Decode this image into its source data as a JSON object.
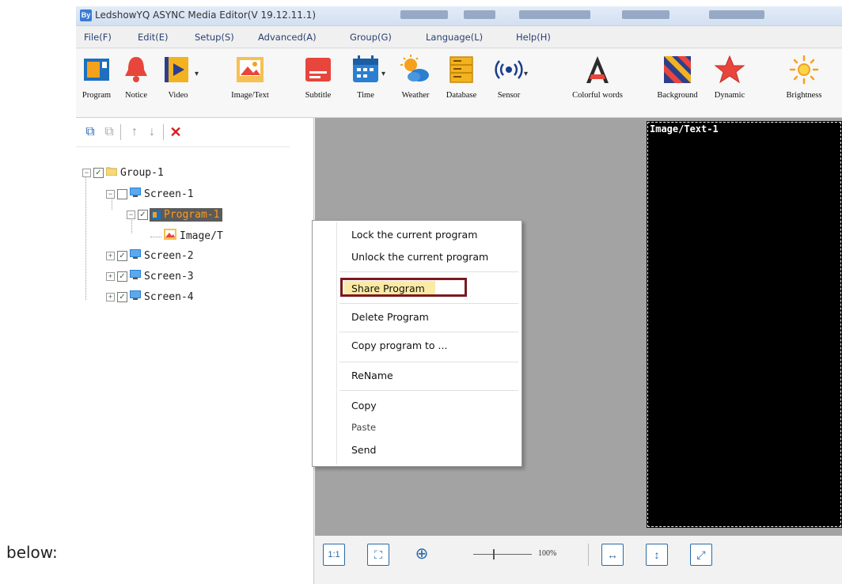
{
  "page": {
    "caption_top": "",
    "caption_bottom": "below:"
  },
  "window": {
    "title": "LedshowYQ ASYNC Media Editor(V 19.12.11.1)"
  },
  "menu": [
    "File(F)",
    "Edit(E)",
    "Setup(S)",
    "Advanced(A)",
    "Group(G)",
    "Language(L)",
    "Help(H)"
  ],
  "toolbar": {
    "items": [
      {
        "label": "Program",
        "icon": "program-icon"
      },
      {
        "label": "Notice",
        "icon": "bell-icon"
      },
      {
        "label": "Video",
        "icon": "video-icon"
      },
      {
        "label": "Image/Text",
        "icon": "image-text-icon"
      },
      {
        "label": "Subtitle",
        "icon": "subtitle-icon"
      },
      {
        "label": "Time",
        "icon": "calendar-icon"
      },
      {
        "label": "Weather",
        "icon": "weather-icon"
      },
      {
        "label": "Database",
        "icon": "database-icon"
      },
      {
        "label": "Sensor",
        "icon": "sensor-icon"
      },
      {
        "label": "Colorful words",
        "icon": "colorful-words-icon"
      },
      {
        "label": "Background",
        "icon": "background-icon"
      },
      {
        "label": "Dynamic",
        "icon": "star-icon"
      },
      {
        "label": "Brightness",
        "icon": "brightness-icon"
      }
    ]
  },
  "tree": {
    "group": "Group-1",
    "screen1": "Screen-1",
    "program1": "Program-1",
    "imagetext": "Image/T",
    "screen2": "Screen-2",
    "screen3": "Screen-3",
    "screen4": "Screen-4"
  },
  "preview": {
    "label": "Image/Text-1"
  },
  "zoom": {
    "percent_label": "100%",
    "value": 100
  },
  "context_menu": {
    "items": [
      "Lock the current program",
      "Unlock the current program",
      "Share Program",
      "Delete Program",
      "Copy program to ...",
      "ReName",
      "Copy",
      "Paste",
      "Send"
    ],
    "highlighted": "Share Program"
  },
  "colors": {
    "highlight_border": "#7a1a1f",
    "highlight_fill": "#fbeaa5",
    "selected_program_bg": "#5b5b5b",
    "selected_program_text": "#ff9a1f"
  }
}
